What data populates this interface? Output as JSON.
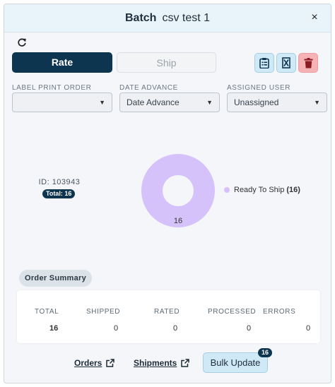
{
  "header": {
    "batch_word": "Batch",
    "batch_name": "csv test 1",
    "close_glyph": "×"
  },
  "tabs": {
    "rate": "Rate",
    "ship": "Ship"
  },
  "fields": {
    "label_print_order": {
      "label": "LABEL PRINT ORDER",
      "value": ""
    },
    "date_advance": {
      "label": "DATE ADVANCE",
      "value": "Date Advance"
    },
    "assigned_user": {
      "label": "ASSIGNED USER",
      "value": "Unassigned"
    }
  },
  "batch_info": {
    "id_text": "ID: 103943",
    "total_text": "Total: 16"
  },
  "chart_data": {
    "type": "pie",
    "categories": [
      "Ready To Ship"
    ],
    "values": [
      16
    ],
    "color": "#d6c2fa",
    "legend": {
      "label": "Ready To Ship",
      "count": "(16)"
    },
    "slice_label": "16"
  },
  "summary": {
    "chip": "Order Summary",
    "columns": [
      {
        "head": "TOTAL",
        "value": "16"
      },
      {
        "head": "SHIPPED",
        "value": "0"
      },
      {
        "head": "RATED",
        "value": "0"
      },
      {
        "head": "PROCESSED",
        "value": "0"
      },
      {
        "head": "ERRORS",
        "value": "0"
      }
    ]
  },
  "footer": {
    "orders": "Orders",
    "shipments": "Shipments",
    "bulk_update": "Bulk Update",
    "bulk_badge": "16"
  },
  "icons": {
    "refresh": "refresh-icon",
    "clipboard": "clipboard-list-icon",
    "hourglass": "hourglass-cancel-icon",
    "trash": "trash-icon",
    "external": "external-link-icon"
  },
  "colors": {
    "primary": "#0e3550",
    "light_blue": "#cfe9f7",
    "danger": "#f6b3b6",
    "chart": "#d6c2fa"
  }
}
